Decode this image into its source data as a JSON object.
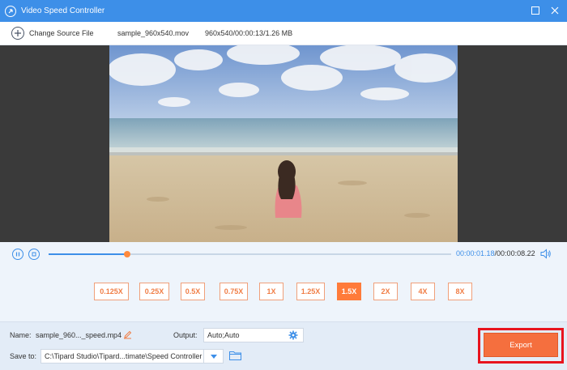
{
  "window": {
    "title": "Video Speed Controller"
  },
  "toolbar": {
    "change_source_label": "Change Source File",
    "file_name": "sample_960x540.mov",
    "file_meta": "960x540/00:00:13/1.26 MB"
  },
  "playback": {
    "current_time": "00:00:01.18",
    "total_time": "/00:00:08.22",
    "progress": 0.196
  },
  "speeds": [
    {
      "label": "0.125X",
      "active": false
    },
    {
      "label": "0.25X",
      "active": false
    },
    {
      "label": "0.5X",
      "active": false
    },
    {
      "label": "0.75X",
      "active": false
    },
    {
      "label": "1X",
      "active": false
    },
    {
      "label": "1.25X",
      "active": false
    },
    {
      "label": "1.5X",
      "active": true
    },
    {
      "label": "2X",
      "active": false
    },
    {
      "label": "4X",
      "active": false
    },
    {
      "label": "8X",
      "active": false
    }
  ],
  "output": {
    "name_label": "Name:",
    "name_value": "sample_960..._speed.mp4",
    "output_label": "Output:",
    "output_value": "Auto;Auto",
    "save_label": "Save to:",
    "save_path": "C:\\Tipard Studio\\Tipard...timate\\Speed Controller",
    "export_label": "Export"
  },
  "colors": {
    "accent": "#3d8fe8",
    "speed_active": "#ff7b3a",
    "export": "#f56f3e",
    "highlight_border": "#e8141e"
  }
}
